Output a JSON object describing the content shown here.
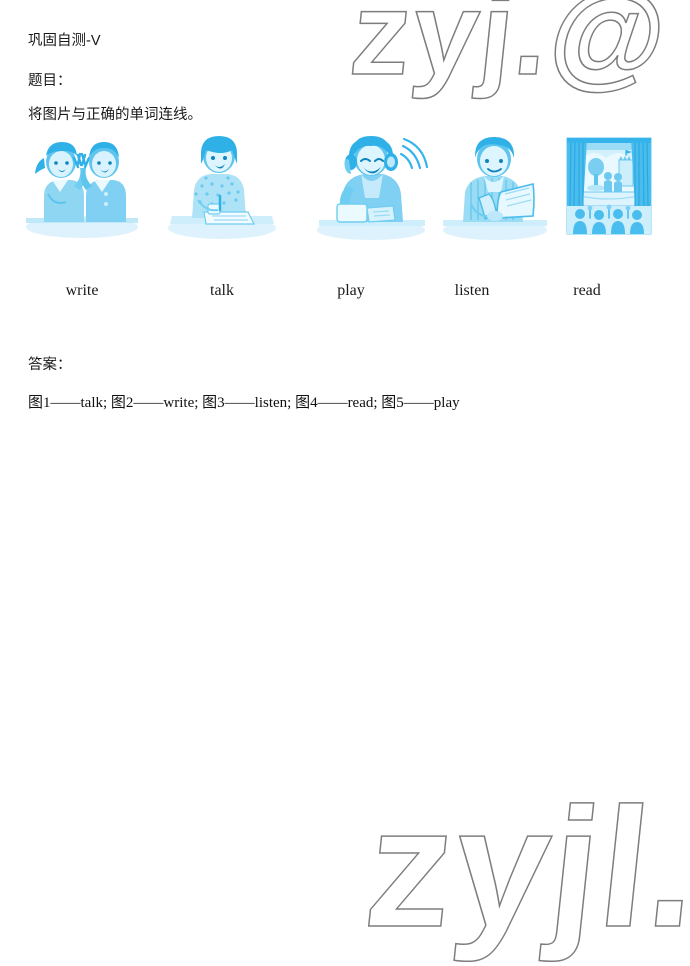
{
  "page": {
    "background_color": "#ffffff",
    "text_color": "#1a1a1a",
    "illustration_color": "#35b4ec",
    "illustration_color_light": "#b8e6f8",
    "watermark_color": "#7d7d7d"
  },
  "watermarks": {
    "top": "zyj.@",
    "bottom": "zyjl.@"
  },
  "header": {
    "title": "巩固自测-V",
    "prompt_label": "题目：",
    "instruction": "将图片与正确的单词连线。"
  },
  "exercise": {
    "pictures": [
      {
        "index": 1,
        "icon": "two-children-talking-icon",
        "alt": "两个小朋友面对面交谈"
      },
      {
        "index": 2,
        "icon": "girl-writing-at-desk-icon",
        "alt": "女孩在桌前写字"
      },
      {
        "index": 3,
        "icon": "boy-with-headphones-listening-icon",
        "alt": "男孩戴耳机听录音"
      },
      {
        "index": 4,
        "icon": "boy-reading-book-icon",
        "alt": "男孩在读书"
      },
      {
        "index": 5,
        "icon": "stage-play-theater-icon",
        "alt": "舞台演出与观众"
      }
    ],
    "words": [
      "write",
      "talk",
      "play",
      "listen",
      "read"
    ]
  },
  "answer": {
    "label": "答案：",
    "text": "图1——talk; 图2——write; 图3——listen; 图4——read; 图5——play",
    "pairs": [
      {
        "picture": "图1",
        "word": "talk"
      },
      {
        "picture": "图2",
        "word": "write"
      },
      {
        "picture": "图3",
        "word": "listen"
      },
      {
        "picture": "图4",
        "word": "read"
      },
      {
        "picture": "图5",
        "word": "play"
      }
    ]
  }
}
